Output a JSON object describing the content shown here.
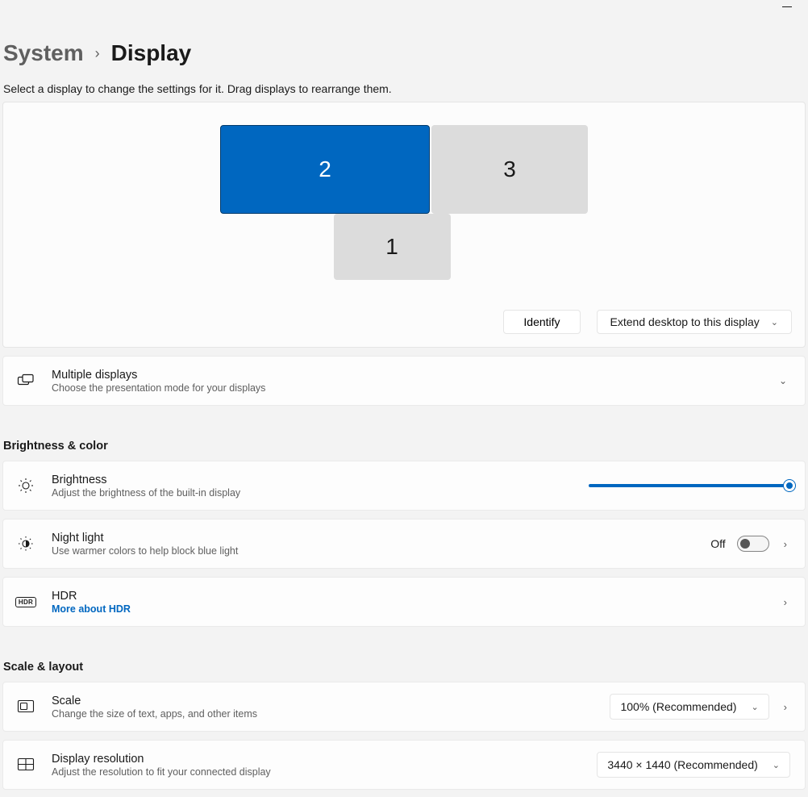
{
  "window": {
    "minimize_icon": "minimize"
  },
  "breadcrumb": {
    "parent": "System",
    "current": "Display"
  },
  "help_text": "Select a display to change the settings for it. Drag displays to rearrange them.",
  "arrange": {
    "monitors": [
      {
        "id": "2",
        "selected": true
      },
      {
        "id": "3",
        "selected": false
      },
      {
        "id": "1",
        "selected": false
      }
    ],
    "identify_label": "Identify",
    "mode_label": "Extend desktop to this display"
  },
  "multiple_displays": {
    "title": "Multiple displays",
    "sub": "Choose the presentation mode for your displays"
  },
  "sections": {
    "brightness_color": "Brightness & color",
    "scale_layout": "Scale & layout"
  },
  "brightness": {
    "title": "Brightness",
    "sub": "Adjust the brightness of the built-in display",
    "value_pct": 100
  },
  "night_light": {
    "title": "Night light",
    "sub": "Use warmer colors to help block blue light",
    "state_label": "Off",
    "state": false
  },
  "hdr": {
    "title": "HDR",
    "link": "More about HDR",
    "badge": "HDR"
  },
  "scale": {
    "title": "Scale",
    "sub": "Change the size of text, apps, and other items",
    "value": "100% (Recommended)"
  },
  "resolution": {
    "title": "Display resolution",
    "sub": "Adjust the resolution to fit your connected display",
    "value": "3440 × 1440 (Recommended)"
  }
}
